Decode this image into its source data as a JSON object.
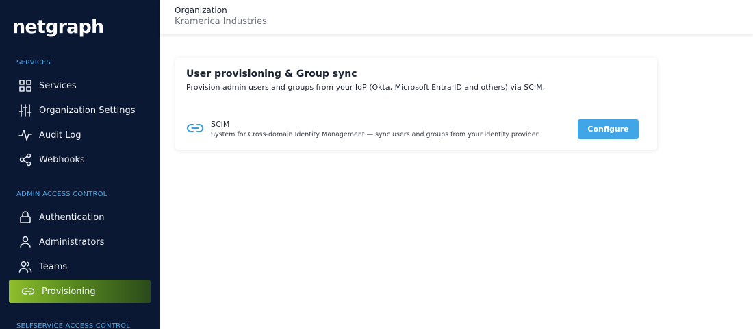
{
  "sidebar": {
    "logo": "netgraph",
    "sections": [
      {
        "label": "SERVICES"
      },
      {
        "label": "ADMIN ACCESS CONTROL"
      },
      {
        "label": "SELFSERVICE ACCESS CONTROL"
      }
    ],
    "items": [
      {
        "label": "Services",
        "icon": "grid-icon"
      },
      {
        "label": "Organization Settings",
        "icon": "sliders-icon"
      },
      {
        "label": "Audit Log",
        "icon": "activity-icon"
      },
      {
        "label": "Webhooks",
        "icon": "share-icon"
      },
      {
        "label": "Authentication",
        "icon": "lock-icon"
      },
      {
        "label": "Administrators",
        "icon": "user-icon"
      },
      {
        "label": "Teams",
        "icon": "users-icon"
      },
      {
        "label": "Provisioning",
        "icon": "link-icon",
        "active": true
      }
    ]
  },
  "header": {
    "label": "Organization",
    "value": "Kramerica Industries"
  },
  "card": {
    "title": "User provisioning & Group sync",
    "subtitle": "Provision admin users and groups from your IdP (Okta, Microsoft Entra ID and others) via SCIM.",
    "scim": {
      "name": "SCIM",
      "description": "System for Cross-domain Identity Management — sync users and groups from your identity provider.",
      "button": "Configure"
    }
  },
  "colors": {
    "sidebar_bg": "#0b1833",
    "section_label": "#4aa8ea",
    "active_gradient_start": "#8fbf2c",
    "button_bg": "#40a6e8"
  }
}
